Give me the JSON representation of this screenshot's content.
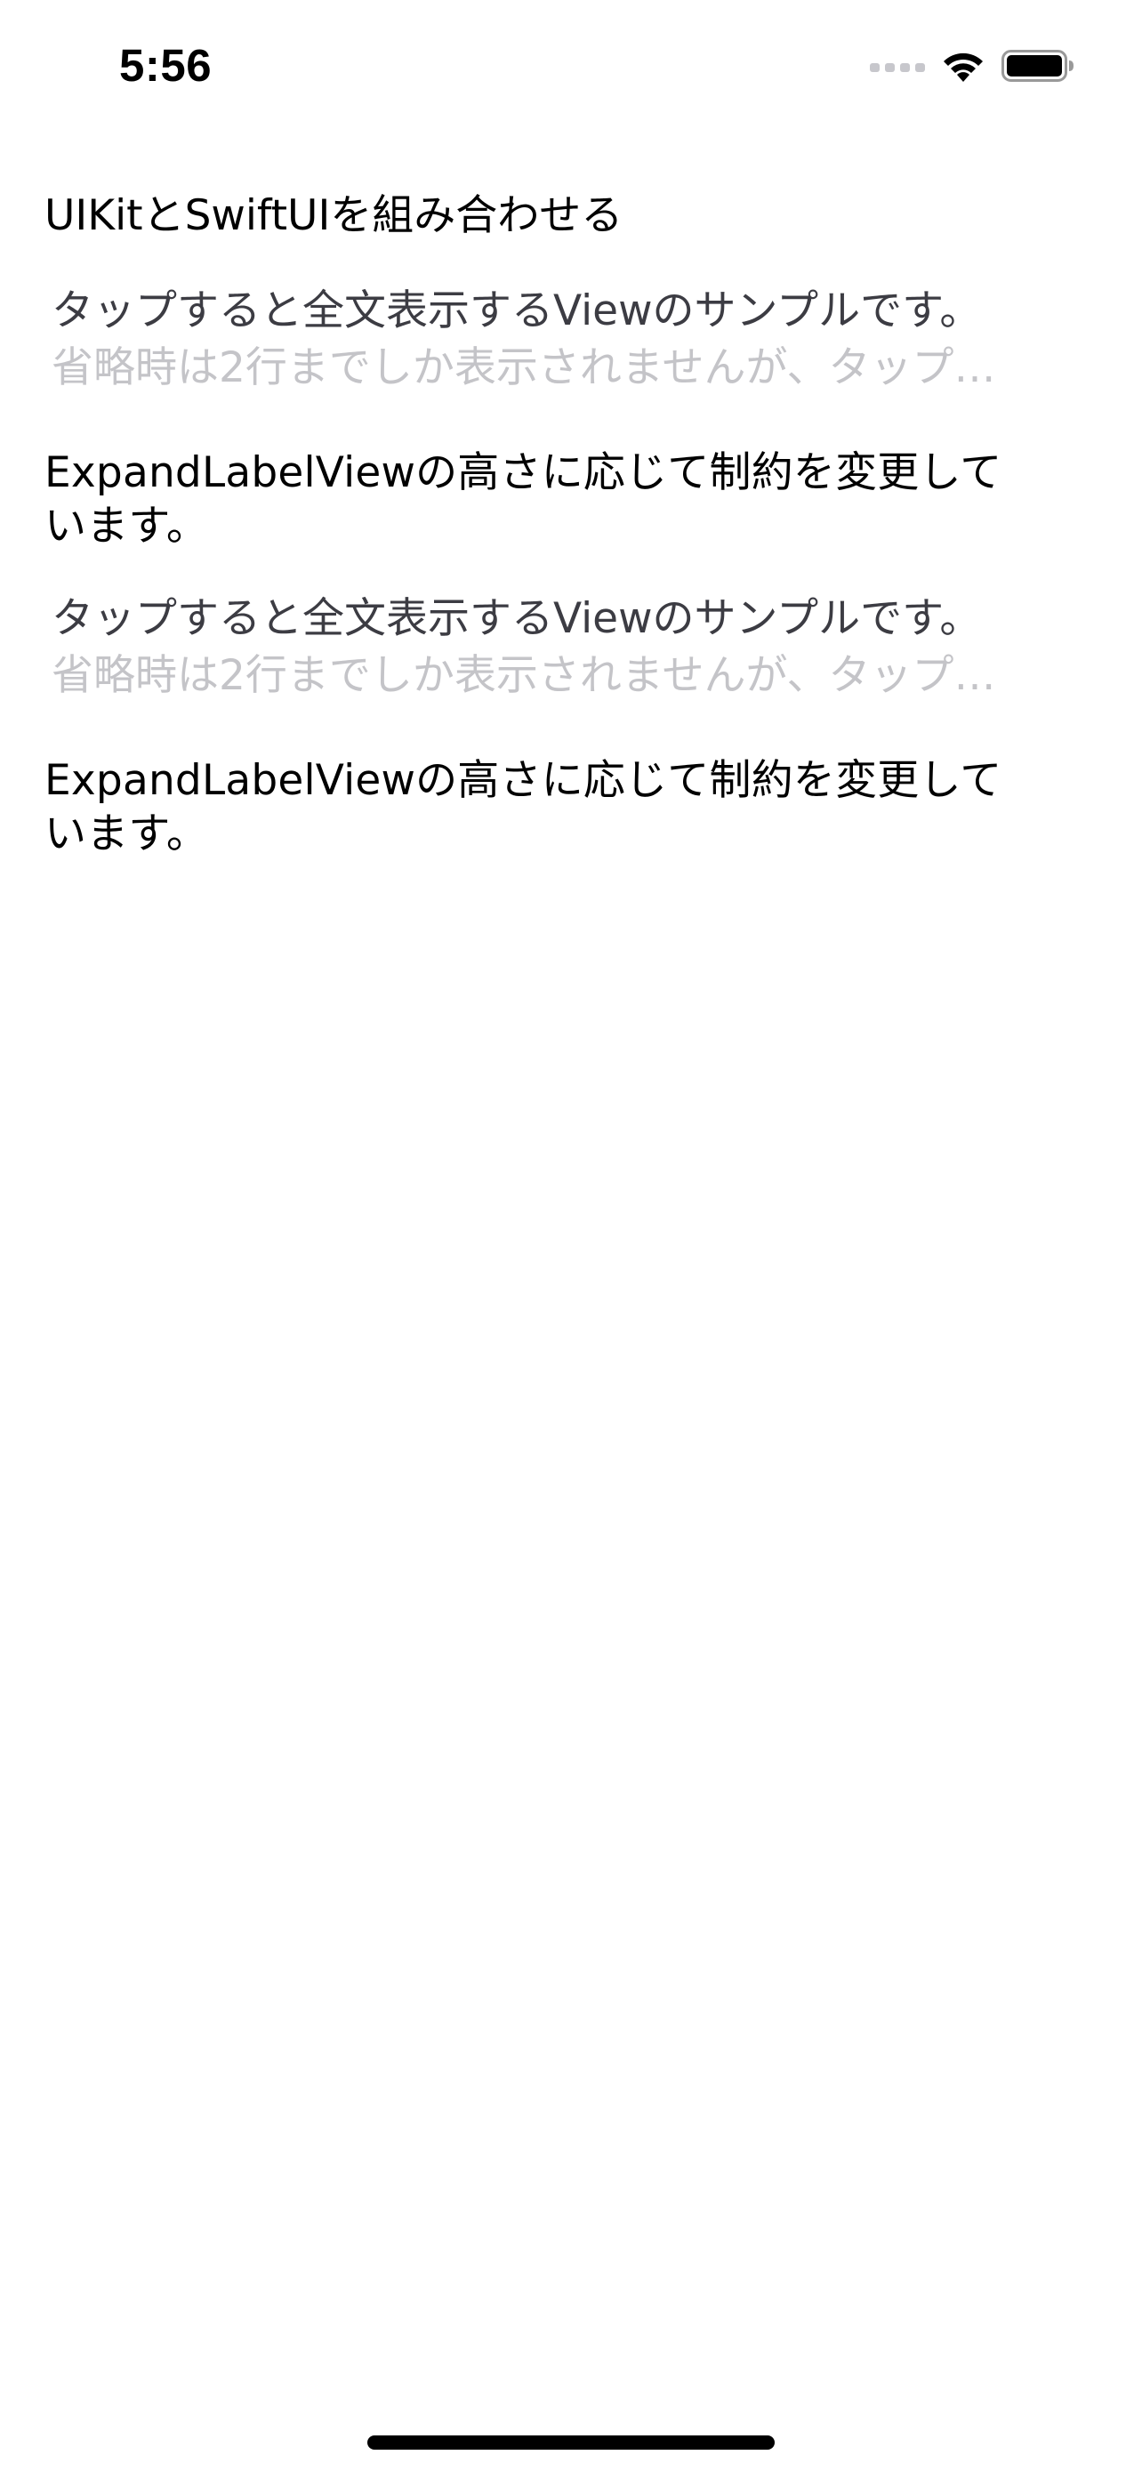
{
  "status_bar": {
    "time": "5:56",
    "signal_icon": "cellular-signal-dots-icon",
    "wifi_icon": "wifi-icon",
    "battery_icon": "battery-full-icon"
  },
  "main": {
    "title": "UIKitとSwiftUIを組み合わせる",
    "sections": [
      {
        "expand_line_1": "タップすると全文表示するViewのサンプルです。",
        "expand_line_2": "省略時は2行までしか表示されませんが、タップ…",
        "body_line_1": "ExpandLabelViewの高さに応じて制約を変更して",
        "body_line_2": "います。"
      },
      {
        "expand_line_1": "タップすると全文表示するViewのサンプルです。",
        "expand_line_2": "省略時は2行までしか表示されませんが、タップ…",
        "body_line_1": "ExpandLabelViewの高さに応じて制約を変更して",
        "body_line_2": "います。"
      }
    ]
  },
  "colors": {
    "background": "#ffffff",
    "text": "#000000",
    "secondary_text": "#3c3c43",
    "faded_text": "#c4c4c8"
  }
}
